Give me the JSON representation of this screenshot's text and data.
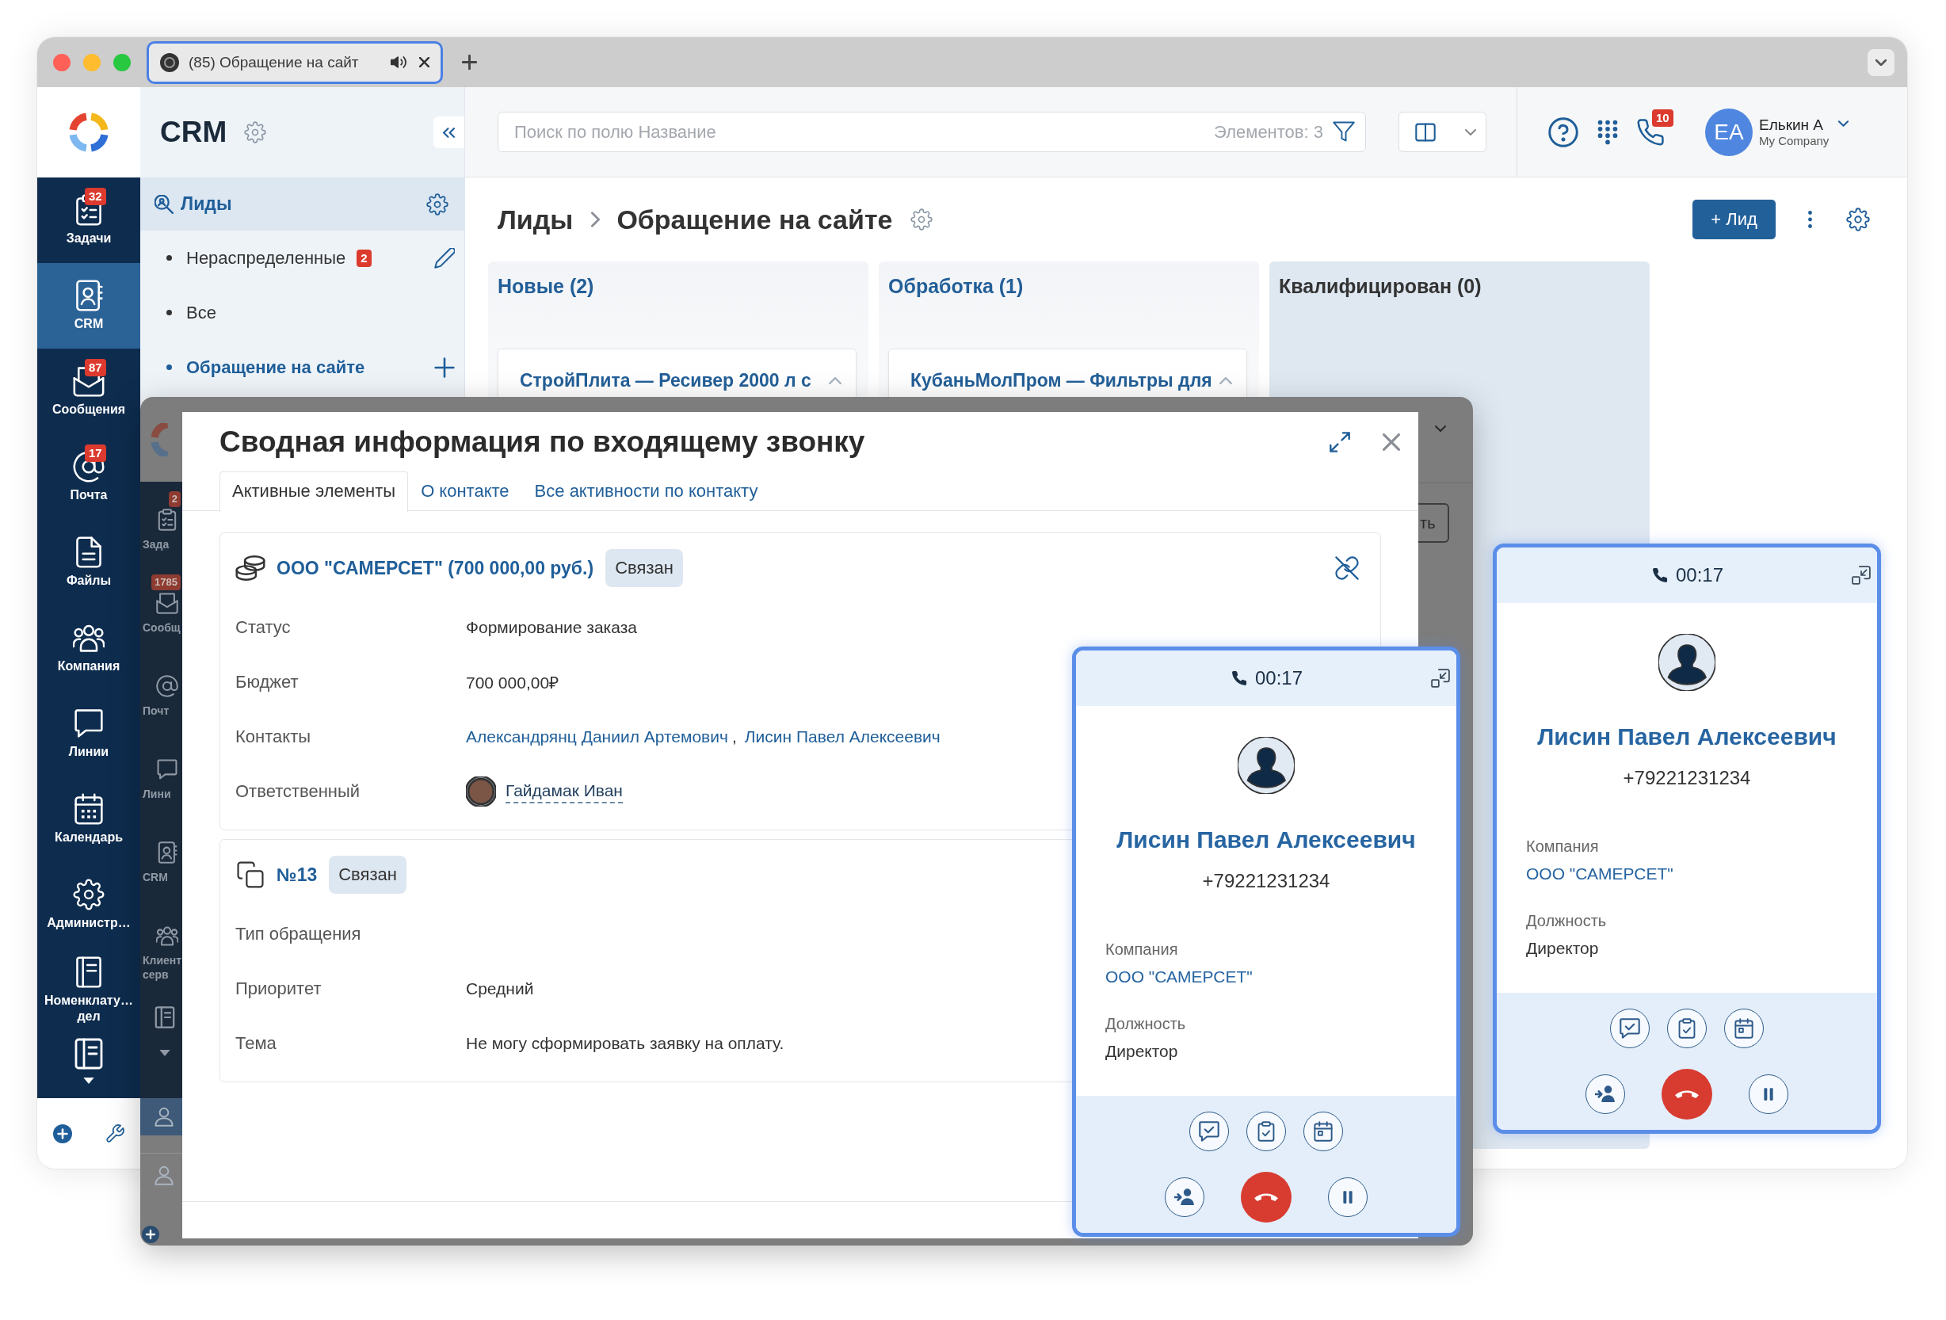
{
  "browser": {
    "tab": {
      "title": "(85) Обращение на сайт",
      "selected": true
    }
  },
  "rail": {
    "items": [
      {
        "label": "Задачи",
        "badge": "32",
        "selected": false
      },
      {
        "label": "CRM",
        "selected": true
      },
      {
        "label": "Сообщения",
        "badge": "87",
        "selected": false
      },
      {
        "label": "Почта",
        "badge": "17",
        "selected": false
      },
      {
        "label": "Файлы",
        "selected": false
      },
      {
        "label": "Компания",
        "selected": false
      },
      {
        "label": "Линии",
        "selected": false
      },
      {
        "label": "Календарь",
        "selected": false
      },
      {
        "label": "Администр…",
        "selected": false
      },
      {
        "label": "Номенклату… дел",
        "selected": false
      }
    ]
  },
  "crm_panel": {
    "title": "CRM",
    "section": {
      "label": "Лиды",
      "selected": true
    },
    "items": [
      {
        "label": "Нераспределенные",
        "badge": "2",
        "kind": "edit",
        "selected": false
      },
      {
        "label": "Все",
        "kind": "plain",
        "selected": false
      },
      {
        "label": "Обращение на сайте",
        "kind": "add",
        "selected": true
      }
    ]
  },
  "top_bar": {
    "search": {
      "placeholder": "Поиск по полю Название",
      "count": "Элементов: 3"
    },
    "calls_badge": "10",
    "user": {
      "initials": "EA",
      "name": "Елькин А",
      "company": "My Company"
    }
  },
  "page": {
    "breadcrumb": "Лиды",
    "title": "Обращение на сайте",
    "add_button": "+ Лид"
  },
  "kanban": {
    "columns": [
      {
        "title": "Новые (2)",
        "kind": "stage",
        "cards": [
          "СтройПлита — Ресивер 2000 л с"
        ]
      },
      {
        "title": "Обработка (1)",
        "kind": "stage",
        "cards": [
          "КубаньМолПром — Фильтры для"
        ]
      },
      {
        "title": "Квалифицирован (0)",
        "kind": "final"
      }
    ]
  },
  "background_window": {
    "sidebar": [
      {
        "label": "Зада",
        "badge": "2"
      },
      {
        "label": "Сообщ",
        "badge": "1785"
      },
      {
        "label": "Почт"
      },
      {
        "label": "Лини"
      },
      {
        "label": "CRM"
      },
      {
        "label": "Клиент серв"
      }
    ],
    "button": "ть"
  },
  "dialog": {
    "title": "Сводная информация по входящему звонку",
    "tabs": [
      {
        "label": "Активные элементы",
        "selected": true
      },
      {
        "label": "О контакте",
        "selected": false
      },
      {
        "label": "Все активности по контакту",
        "selected": false
      }
    ],
    "entities": [
      {
        "kind": "deal",
        "title": "ООО \"САМЕРСЕТ\" (700 000,00 руб.)",
        "status": "Связан",
        "fields": [
          {
            "kind": "text",
            "label": "Статус",
            "value": "Формирование заказа"
          },
          {
            "kind": "text",
            "label": "Бюджет",
            "value": "700 000,00₽"
          },
          {
            "kind": "links",
            "label": "Контакты",
            "links": [
              "Александрянц Даниил Артемович",
              "Лисин Павел Алексеевич"
            ],
            "separator": ","
          },
          {
            "kind": "person",
            "label": "Ответственный",
            "value": "Гайдамак Иван"
          }
        ]
      },
      {
        "kind": "request",
        "title": "№13",
        "status": "Связан",
        "fields": [
          {
            "kind": "text",
            "label": "Тип обращения"
          },
          {
            "kind": "text",
            "label": "Приоритет",
            "value": "Средний"
          },
          {
            "kind": "text",
            "label": "Тема",
            "value": "Не могу сформировать заявку на оплату."
          }
        ]
      }
    ]
  },
  "call_cards": [
    {
      "timer": "00:17",
      "name": "Лисин Павел Алексеевич",
      "phone": "+79221231234",
      "fields": [
        {
          "label": "Компания",
          "value": "ООО \"САМЕРСЕТ\"",
          "link": true
        },
        {
          "label": "Должность",
          "value": "Директор",
          "link": false
        }
      ]
    },
    {
      "timer": "00:17",
      "name": "Лисин Павел Алексеевич",
      "phone": "+79221231234",
      "fields": [
        {
          "label": "Компания",
          "value": "ООО \"САМЕРСЕТ\"",
          "link": true
        },
        {
          "label": "Должность",
          "value": "Директор",
          "link": false
        }
      ]
    }
  ]
}
